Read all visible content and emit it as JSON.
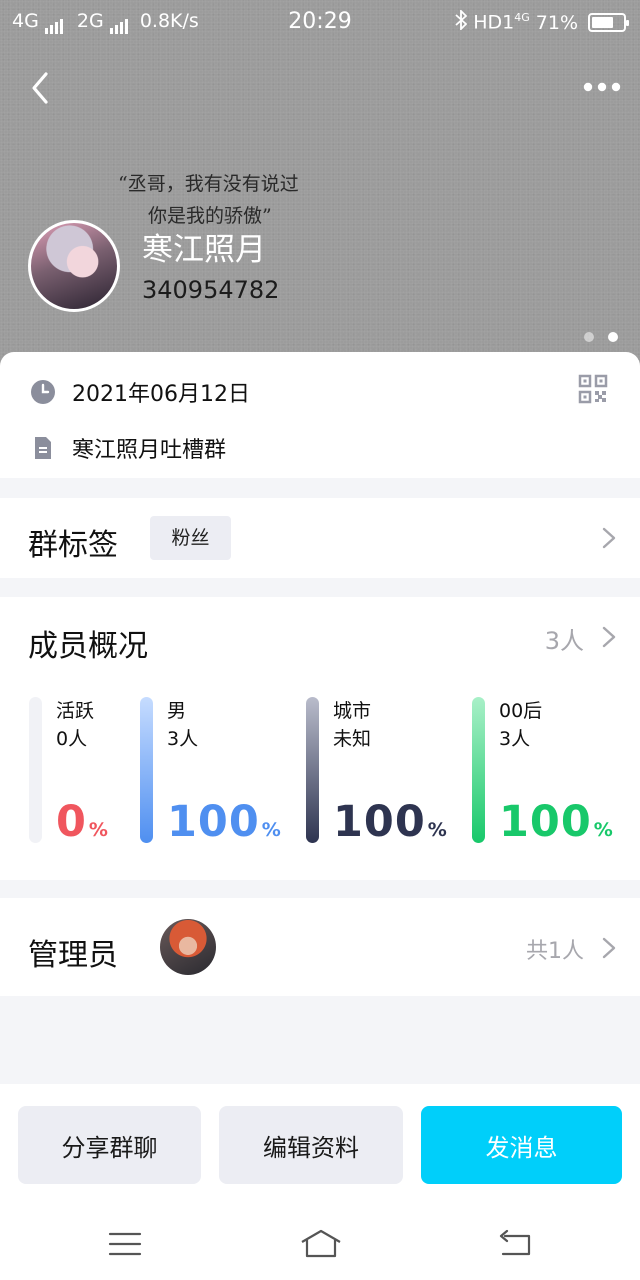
{
  "status_bar": {
    "network1": "4G",
    "network2": "2G",
    "speed": "0.8K/s",
    "time": "20:29",
    "hd": "HD1",
    "hd_sup": "4G",
    "battery_text": "71%",
    "battery_level": 0.71
  },
  "header": {
    "quote_line1": "“丞哥，我有没有说过",
    "quote_line2": "你是我的骄傲”",
    "group_name": "寒江照月",
    "group_id": "340954782"
  },
  "info": {
    "date": "2021年06月12日",
    "description": "寒江照月吐槽群"
  },
  "tags_section": {
    "title": "群标签",
    "tag": "粉丝"
  },
  "members_section": {
    "title": "成员概况",
    "count": "3人",
    "stats": [
      {
        "label1": "活跃",
        "label2": "0人",
        "value": "0",
        "unit": "%",
        "color": "#f0565e",
        "bar_from": "#f1f2f6",
        "bar_to": "#f1f2f6"
      },
      {
        "label1": "男",
        "label2": "3人",
        "value": "100",
        "unit": "%",
        "color": "#4f8ff0",
        "bar_from": "#c6dcff",
        "bar_to": "#4f8ff0"
      },
      {
        "label1": "城市",
        "label2": "未知",
        "value": "100",
        "unit": "%",
        "color": "#2e3450",
        "bar_from": "#b9bccb",
        "bar_to": "#2e3450"
      },
      {
        "label1": "00后",
        "label2": "3人",
        "value": "100",
        "unit": "%",
        "color": "#18c86a",
        "bar_from": "#a9f0c8",
        "bar_to": "#18c86a"
      }
    ]
  },
  "admin_section": {
    "title": "管理员",
    "count": "共1人"
  },
  "actions": {
    "share": "分享群聊",
    "edit": "编辑资料",
    "message": "发消息"
  }
}
